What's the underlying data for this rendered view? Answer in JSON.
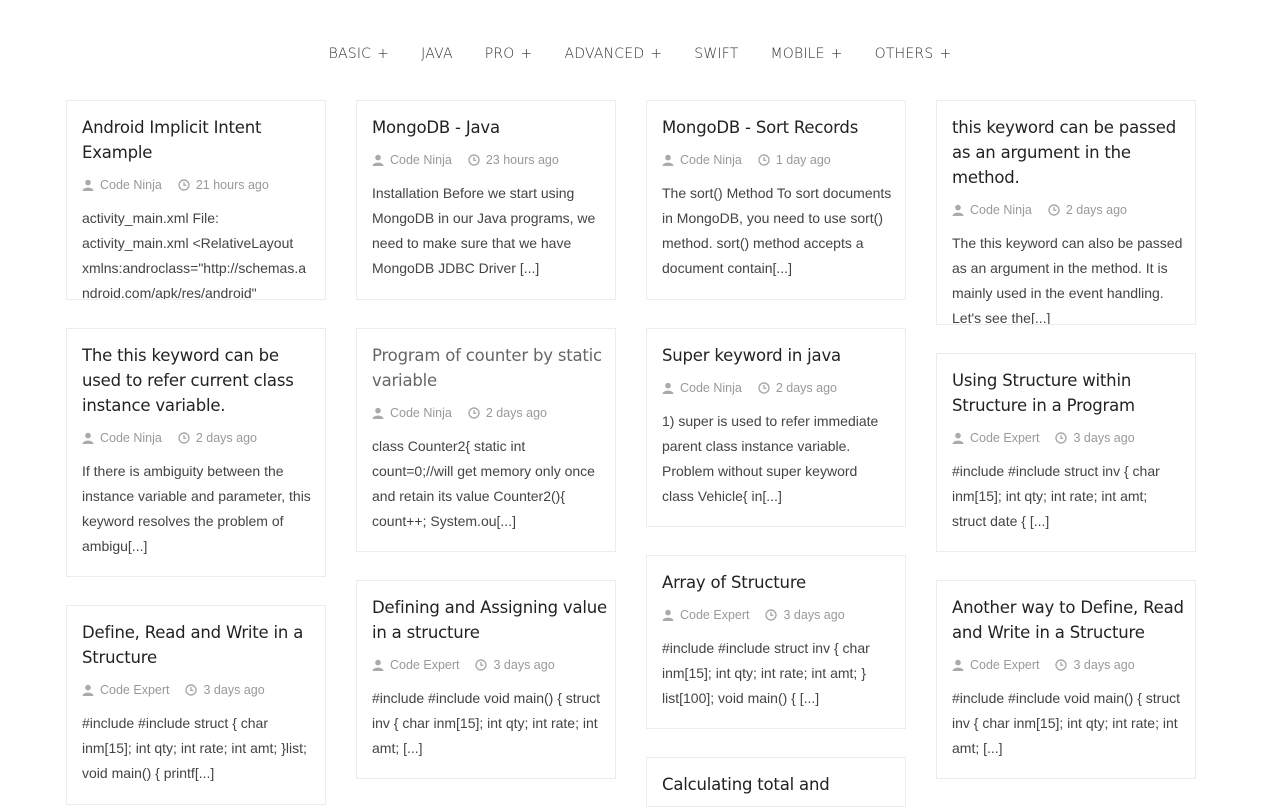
{
  "nav": [
    {
      "label": "BASIC",
      "plus": "+"
    },
    {
      "label": "JAVA",
      "plus": ""
    },
    {
      "label": "PRO",
      "plus": "+"
    },
    {
      "label": "ADVANCED",
      "plus": "+"
    },
    {
      "label": "SWIFT",
      "plus": ""
    },
    {
      "label": "MOBILE",
      "plus": "+"
    },
    {
      "label": "OTHERS",
      "plus": "+"
    }
  ],
  "posts": [
    {
      "title": "Android Implicit Intent Example",
      "author": "Code Ninja",
      "time": "21 hours ago",
      "excerpt": "activity_main.xml File: activity_main.xml <RelativeLayout xmlns:androclass=\"http://schemas.android.com/apk/res/android\""
    },
    {
      "title": "MongoDB - Java",
      "author": "Code Ninja",
      "time": "23 hours ago",
      "excerpt": "Installation Before we start using MongoDB in our Java programs, we need to make sure that we have MongoDB JDBC Driver [...]"
    },
    {
      "title": "MongoDB - Sort Records",
      "author": "Code Ninja",
      "time": "1 day ago",
      "excerpt": "The sort() Method To sort documents in MongoDB, you need to use sort() method. sort() method accepts a document contain[...]"
    },
    {
      "title": "this keyword can be passed as an argument in the method.",
      "author": "Code Ninja",
      "time": "2 days ago",
      "excerpt": "The this keyword can also be passed as an argument in the method. It is mainly used in the event handling. Let's see the[...]"
    },
    {
      "title": "The this keyword can be used to refer current class instance variable.",
      "author": "Code Ninja",
      "time": "2 days ago",
      "excerpt": "  If there is ambiguity between the instance variable and parameter, this keyword resolves the problem of ambigu[...]"
    },
    {
      "title": "Program of counter by static variable",
      "author": "Code Ninja",
      "time": "2 days ago",
      "excerpt": "class Counter2{ static int count=0;//will get memory only once and retain its value Counter2(){ count++; System.ou[...]"
    },
    {
      "title": "Super keyword in java",
      "author": "Code Ninja",
      "time": "2 days ago",
      "excerpt": "1) super is used to refer immediate parent class instance variable. Problem without super keyword class Vehicle{ in[...]"
    },
    {
      "title": "Using Structure within Structure in a Program",
      "author": "Code Expert",
      "time": "3 days ago",
      "excerpt": "#include #include struct inv { char inm[15]; int qty; int rate; int amt; struct date { [...]"
    },
    {
      "title": "Define, Read and Write in a Structure",
      "author": "Code Expert",
      "time": "3 days ago",
      "excerpt": "#include #include struct { char inm[15]; int qty; int rate; int amt; }list; void main() { printf[...]"
    },
    {
      "title": "Defining and Assigning value in a structure",
      "author": "Code Expert",
      "time": "3 days ago",
      "excerpt": "#include #include void main() { struct inv { char inm[15]; int qty; int rate; int amt; [...]"
    },
    {
      "title": "Array of Structure",
      "author": "Code Expert",
      "time": "3 days ago",
      "excerpt": "#include #include struct inv { char inm[15]; int qty; int rate; int amt; } list[100]; void main() { [...]"
    },
    {
      "title": "Another way to Define, Read and Write in a Structure",
      "author": "Code Expert",
      "time": "3 days ago",
      "excerpt": "#include #include void main() { struct inv { char inm[15]; int qty; int rate; int amt; [...]"
    },
    {
      "title": "Calculating total and",
      "author": "",
      "time": "",
      "excerpt": ""
    }
  ],
  "icons": {
    "author": "user-icon",
    "time": "clock-icon"
  },
  "colors": {
    "meta": "#999999",
    "title": "#222222",
    "border": "#ececec"
  }
}
